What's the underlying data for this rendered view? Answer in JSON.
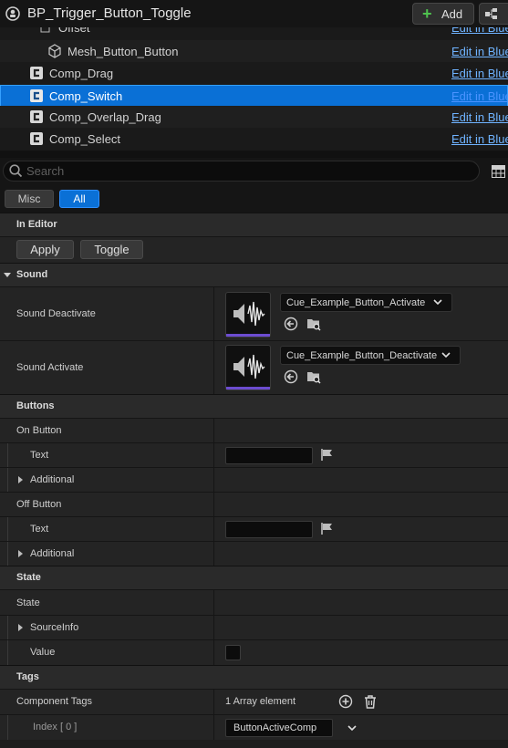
{
  "window": {
    "title": "BP_Trigger_Button_Toggle",
    "add_label": "Add"
  },
  "tree": {
    "partial_label": "Offset",
    "partial_link": "Edit in Blueprint",
    "rows": [
      {
        "label": "Mesh_Button_Button",
        "link": "Edit in Blueprint"
      },
      {
        "label": "Comp_Drag",
        "link": "Edit in Blueprint"
      },
      {
        "label": "Comp_Switch",
        "link": "Edit in Blueprint"
      },
      {
        "label": "Comp_Overlap_Drag",
        "link": "Edit in Blueprint"
      },
      {
        "label": "Comp_Select",
        "link": "Edit in Blueprint"
      }
    ]
  },
  "search": {
    "placeholder": "Search",
    "value": ""
  },
  "filters": {
    "misc": "Misc",
    "all": "All"
  },
  "sections": {
    "in_editor": "In Editor",
    "sound": "Sound",
    "buttons": "Buttons",
    "state": "State",
    "tags": "Tags"
  },
  "in_editor": {
    "apply": "Apply",
    "toggle": "Toggle"
  },
  "sound": {
    "deactivate_label": "Sound Deactivate",
    "deactivate_value": "Cue_Example_Button_Activate",
    "activate_label": "Sound Activate",
    "activate_value": "Cue_Example_Button_Deactivate"
  },
  "buttons": {
    "on_button": "On Button",
    "off_button": "Off Button",
    "text": "Text",
    "additional": "Additional",
    "on_text_value": "",
    "off_text_value": ""
  },
  "state": {
    "state": "State",
    "source_info": "SourceInfo",
    "value": "Value",
    "checked": false
  },
  "tags": {
    "component_tags": "Component Tags",
    "array_count": "1 Array element",
    "index_label": "Index [ 0 ]",
    "index_value": "ButtonActiveComp"
  },
  "colors": {
    "selection": "#0a70d6",
    "link": "#6fb3ff",
    "add_plus": "#4fc24f",
    "thumb_accent": "#6c4cd0"
  }
}
